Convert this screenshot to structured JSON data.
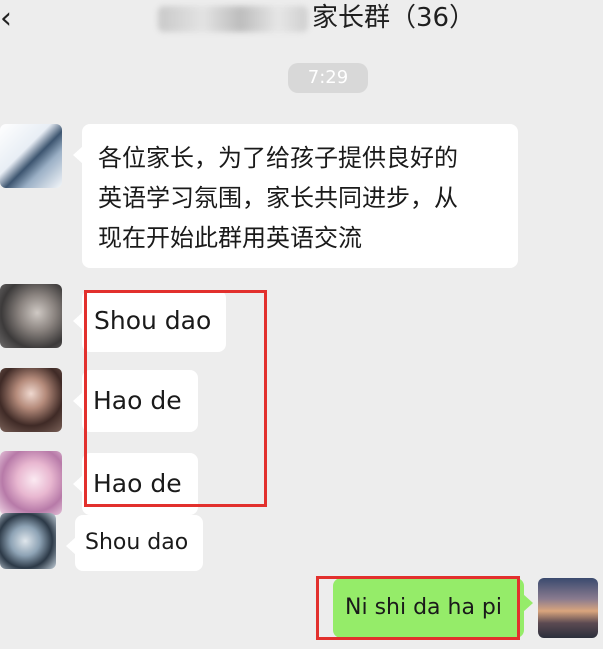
{
  "header": {
    "back_icon": "chevron-left-icon",
    "back_glyph": "‹",
    "title_visible": "家长群（36）"
  },
  "time_label": "7:29",
  "messages": [
    {
      "side": "left",
      "avatar": "avatar-1",
      "text_lines": [
        "各位家长，为了给孩子提供良好的",
        "英语学习氛围，家长共同进步，从",
        "现在开始此群用英语交流"
      ]
    },
    {
      "side": "left",
      "avatar": "avatar-2",
      "text": "Shou dao"
    },
    {
      "side": "left",
      "avatar": "avatar-3",
      "text": "Hao de"
    },
    {
      "side": "left",
      "avatar": "avatar-4",
      "text": "Hao de"
    },
    {
      "side": "left",
      "avatar": "avatar-5",
      "text": "Shou dao"
    },
    {
      "side": "right",
      "avatar": "avatar-6",
      "text": "Ni shi da ha pi"
    }
  ],
  "colors": {
    "background": "#ededed",
    "incoming_bubble": "#ffffff",
    "outgoing_bubble": "#95ec69",
    "annotation_red": "#e2302d"
  }
}
